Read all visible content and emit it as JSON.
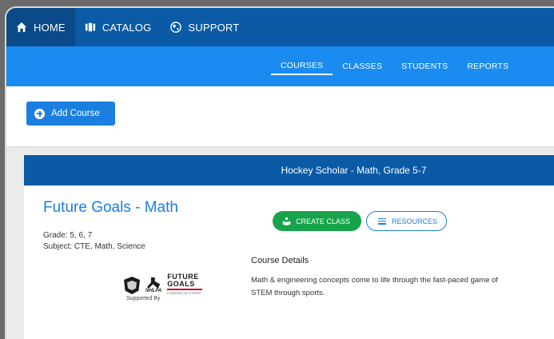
{
  "topnav": {
    "items": [
      {
        "label": "HOME",
        "icon": "home-icon",
        "active": true
      },
      {
        "label": "CATALOG",
        "icon": "catalog-icon",
        "active": false
      },
      {
        "label": "SUPPORT",
        "icon": "globe-icon",
        "active": false
      }
    ]
  },
  "subnav": {
    "items": [
      {
        "label": "COURSES",
        "active": true
      },
      {
        "label": "CLASSES",
        "active": false
      },
      {
        "label": "STUDENTS",
        "active": false
      },
      {
        "label": "REPORTS",
        "active": false
      }
    ]
  },
  "toolbar": {
    "add_course_label": "Add Course"
  },
  "course_card": {
    "header": "Hockey Scholar - Math, Grade 5-7",
    "title": "Future Goals - Math",
    "grade": "Grade: 5, 6, 7",
    "subject": "Subject: CTE, Math, Science",
    "logos": {
      "nhlpa": "NHLPA",
      "future_goals_line1": "FUTURE",
      "future_goals_line2": "GOALS",
      "future_goals_sub": "POWERED BY EVERFI"
    },
    "supported_by": "Supported By",
    "create_class_label": "CREATE CLASS",
    "resources_label": "RESOURCES",
    "details_label": "Course Details",
    "details_line1": "Math & engineering concepts come to life through the fast-paced game of",
    "details_line2": "STEM through sports."
  },
  "colors": {
    "topnav_bg": "#0a5aa6",
    "subnav_bg": "#1a8bf0",
    "accent": "#1a7fe0",
    "create_green": "#17a34a"
  }
}
